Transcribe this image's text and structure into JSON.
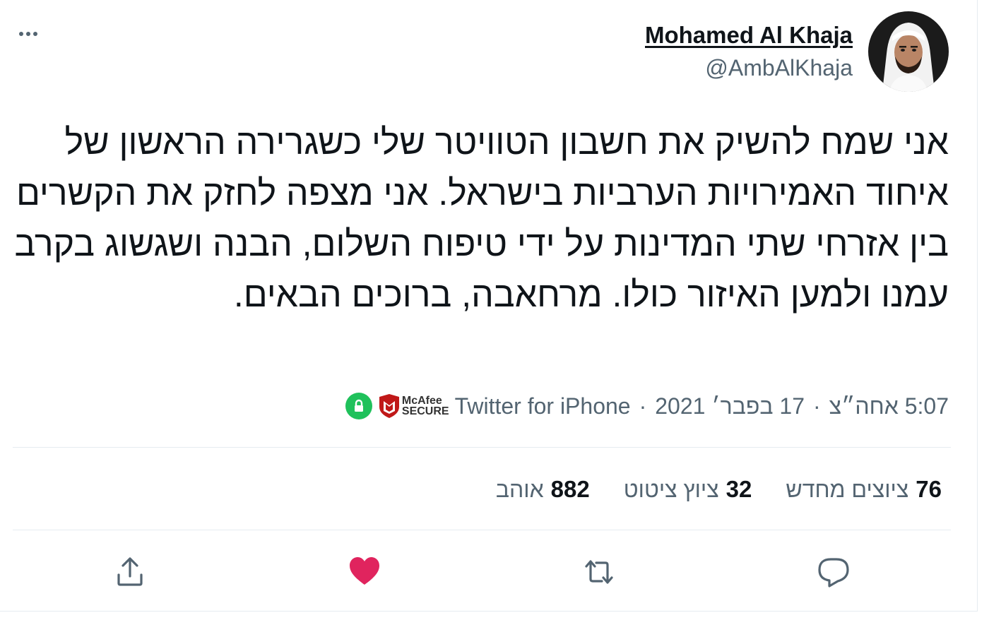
{
  "author": {
    "name": "Mohamed Al Khaja",
    "handle": "@AmbAlKhaja",
    "avatar_icon": "profile-photo"
  },
  "tweet": {
    "text": "אני שמח להשיק את חשבון הטוויטר שלי כשגרירה הראשון של איחוד האמירויות הערביות בישראל. אני מצפה לחזק את הקשרים בין אזרחי שתי המדינות על ידי טיפוח השלום, הבנה ושגשוג בקרב עמנו ולמען האיזור כולו. מרחאבה, ברוכים הבאים."
  },
  "meta": {
    "time": "5:07 אחה״צ",
    "date": "17 בפבר׳ 2021",
    "separator": "·",
    "source": "Twitter for iPhone",
    "badge_text_line1": "McAfee",
    "badge_text_line2": "SECURE",
    "badge_colors": {
      "lock": "#1fc15b",
      "mcafee": "#c01818"
    }
  },
  "stats": {
    "retweets": {
      "count": "76",
      "label": "ציוצים מחדש"
    },
    "quotes": {
      "count": "32",
      "label": "ציוץ ציטוט"
    },
    "likes": {
      "count": "882",
      "label": "אוהב"
    }
  },
  "actions": {
    "reply_icon": "reply-icon",
    "retweet_icon": "retweet-icon",
    "like_icon": "heart-icon",
    "like_color": "#e0245e",
    "share_icon": "share-icon",
    "icon_color": "#536471"
  },
  "more_icon": "more-icon"
}
